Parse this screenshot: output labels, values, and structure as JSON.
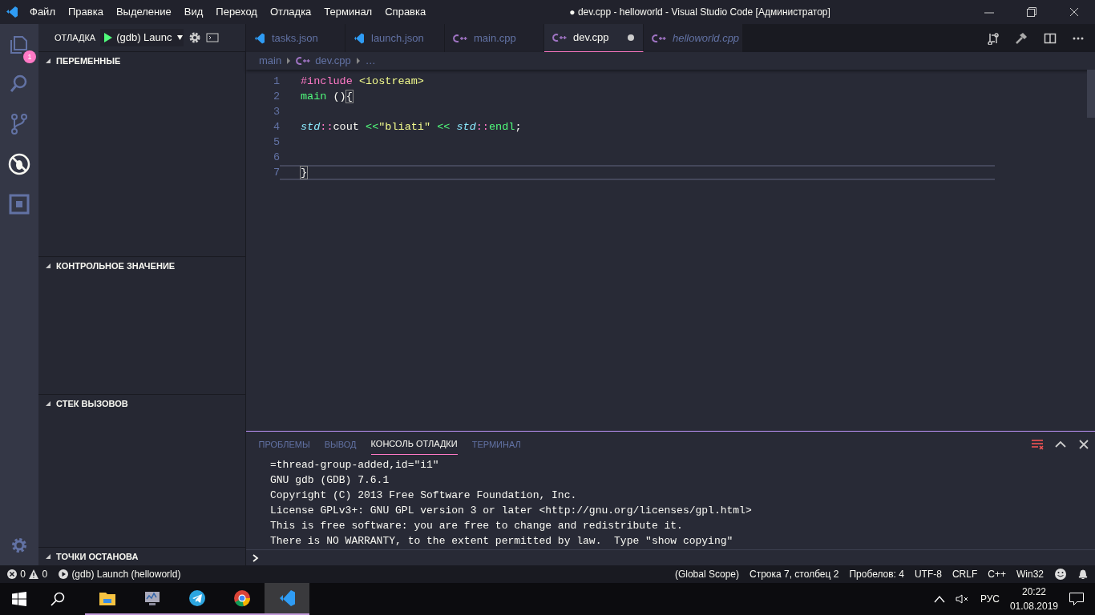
{
  "title_bar": {
    "menu": [
      "Файл",
      "Правка",
      "Выделение",
      "Вид",
      "Переход",
      "Отладка",
      "Терминал",
      "Справка"
    ],
    "title": "● dev.cpp - helloworld - Visual Studio Code [Администратор]"
  },
  "activity_bar": {
    "items": [
      {
        "kind": "files",
        "selected": false,
        "badge": "1"
      },
      {
        "kind": "search",
        "selected": false
      },
      {
        "kind": "scm",
        "selected": false
      },
      {
        "kind": "debug",
        "selected": true
      },
      {
        "kind": "extensions",
        "selected": false
      }
    ]
  },
  "sidebar": {
    "title": "ОТЛАДКА",
    "configuration": "(gdb) Launc",
    "sections": [
      {
        "title": "ПЕРЕМЕННЫЕ",
        "expanded": true
      },
      {
        "title": "КОНТРОЛЬНОЕ ЗНАЧЕНИЕ",
        "expanded": true
      },
      {
        "title": "СТЕК ВЫЗОВОВ",
        "expanded": true
      },
      {
        "title": "ТОЧКИ ОСТАНОВА",
        "expanded": true
      }
    ]
  },
  "tabs": [
    {
      "label": "tasks.json",
      "kind": "json",
      "selected": false,
      "dirty": false,
      "preview": false
    },
    {
      "label": "launch.json",
      "kind": "json",
      "selected": false,
      "dirty": false,
      "preview": false
    },
    {
      "label": "main.cpp",
      "kind": "cpp",
      "selected": false,
      "dirty": false,
      "preview": false
    },
    {
      "label": "dev.cpp",
      "kind": "cpp",
      "selected": true,
      "dirty": true,
      "preview": false
    },
    {
      "label": "helloworld.cpp",
      "kind": "cpp",
      "selected": false,
      "dirty": false,
      "preview": true
    }
  ],
  "breadcrumbs": [
    {
      "label": "main",
      "kind": "folder"
    },
    {
      "label": "dev.cpp",
      "kind": "cpp"
    },
    {
      "label": "…",
      "kind": "more"
    }
  ],
  "editor": {
    "lines": [
      {
        "number": "1",
        "current": false,
        "tokens": [
          {
            "kind": "keyword",
            "text": "#include"
          },
          {
            "kind": "include",
            "text": " <iostream>"
          }
        ]
      },
      {
        "number": "2",
        "current": false,
        "tokens": [
          {
            "kind": "function",
            "text": "main"
          },
          {
            "kind": "plain",
            "text": " ()"
          },
          {
            "kind": "bracket",
            "text": "{"
          }
        ]
      },
      {
        "number": "3",
        "current": false
      },
      {
        "number": "4",
        "current": false,
        "tokens": [
          {
            "kind": "namespace",
            "text": "std"
          },
          {
            "kind": "keyword",
            "text": "::"
          },
          {
            "kind": "plain",
            "text": "cout "
          },
          {
            "kind": "operator",
            "text": "<<"
          },
          {
            "kind": "string",
            "text": "\"bliati\""
          },
          {
            "kind": "operator",
            "text": " <<"
          },
          {
            "kind": "namespace",
            "text": " std"
          },
          {
            "kind": "keyword",
            "text": "::"
          },
          {
            "kind": "function",
            "text": "endl"
          },
          {
            "kind": "plain",
            "text": ";"
          }
        ]
      },
      {
        "number": "5",
        "current": false
      },
      {
        "number": "6",
        "current": false
      },
      {
        "number": "7",
        "current": true,
        "tokens": [
          {
            "kind": "bracket",
            "text": "}"
          }
        ]
      }
    ]
  },
  "panel": {
    "tabs": [
      {
        "label": "ПРОБЛЕМЫ",
        "selected": false
      },
      {
        "label": "ВЫВОД",
        "selected": false
      },
      {
        "label": "КОНСОЛЬ ОТЛАДКИ",
        "selected": true
      },
      {
        "label": "ТЕРМИНАЛ",
        "selected": false
      }
    ],
    "output": [
      "=thread-group-added,id=\"i1\"",
      "GNU gdb (GDB) 7.6.1",
      "Copyright (C) 2013 Free Software Foundation, Inc.",
      "License GPLv3+: GNU GPL version 3 or later <http://gnu.org/licenses/gpl.html>",
      "This is free software: you are free to change and redistribute it.",
      "There is NO WARRANTY, to the extent permitted by law.  Type \"show copying\""
    ]
  },
  "status_bar": {
    "errors": "0",
    "warnings": "0",
    "launch": "(gdb) Launch (helloworld)",
    "items": [
      "(Global Scope)",
      "Строка 7, столбец 2",
      "Пробелов: 4",
      "UTF-8",
      "CRLF",
      "C++",
      "Win32"
    ]
  },
  "taskbar": {
    "apps": [
      {
        "kind": "explorer",
        "active": false
      },
      {
        "kind": "monitor",
        "active": false
      },
      {
        "kind": "telegram",
        "active": false
      },
      {
        "kind": "chrome",
        "active": false
      },
      {
        "kind": "vscode",
        "active": true
      }
    ],
    "language": "РУС",
    "time": "20:22",
    "date": "01.08.2019"
  }
}
